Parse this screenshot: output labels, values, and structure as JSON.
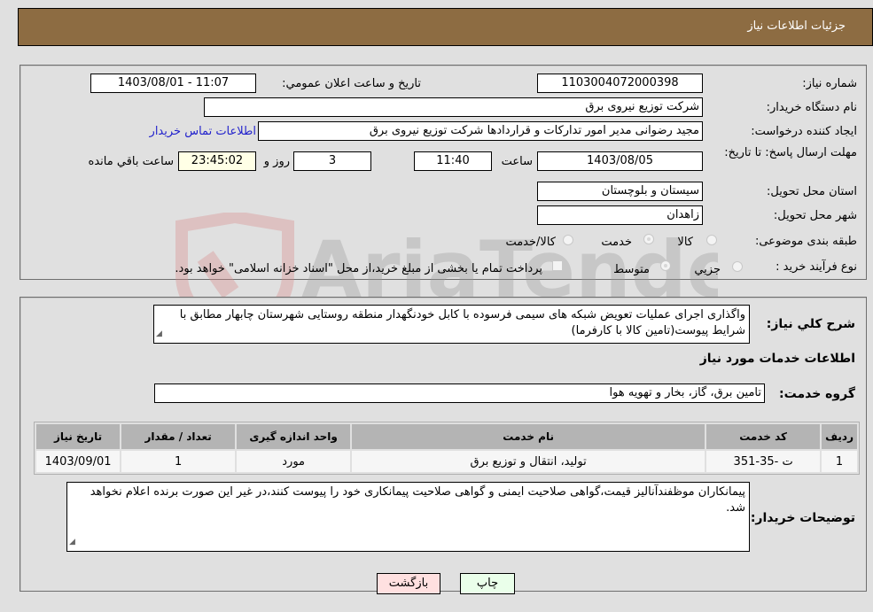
{
  "header": {
    "title": "جزئیات اطلاعات نیاز"
  },
  "fields": {
    "need_number_label": "شماره نیاز:",
    "need_number": "1103004072000398",
    "announce_label": "تاريخ و ساعت اعلان عمومي:",
    "announce_value": "1403/08/01 - 11:07",
    "buyer_org_label": "نام دستگاه خریدار:",
    "buyer_org": "شرکت توزیع نیروی برق",
    "creator_label": "ایجاد کننده درخواست:",
    "creator": "مجید  رضوانی مدیر امور تدارکات و قراردادها شرکت توزیع نیروی برق",
    "contact_link": "اطلاعات تماس خریدار",
    "deadline_label": "مهلت ارسال پاسخ: تا تاریخ:",
    "deadline_date": "1403/08/05",
    "time_label": "ساعت",
    "deadline_time": "11:40",
    "days_value": "3",
    "days_label": "روز و",
    "remaining_time": "23:45:02",
    "remaining_label": "ساعت باقي مانده",
    "province_label": "استان محل تحویل:",
    "province": "سیستان و بلوچستان",
    "city_label": "شهر محل تحویل:",
    "city": "زاهدان",
    "category_label": "طبقه بندی موضوعی:",
    "category_options": [
      "کالا",
      "خدمت",
      "کالا/خدمت"
    ],
    "category_selected": "خدمت",
    "process_label": "نوع فرآیند خرید :",
    "process_options": [
      "جزيي",
      "متوسط"
    ],
    "process_selected": "متوسط",
    "treasury_note": "پرداخت تمام یا بخشی از مبلغ خرید،از محل \"اسناد خزانه اسلامی\" خواهد بود."
  },
  "details": {
    "description_label": "شرح کلي نياز:",
    "description": "واگذاری اجرای عملیات تعویض شبکه های سیمی فرسوده با کابل خودنگهدار منطقه روستایی شهرستان چابهار مطابق با شرایط پیوست(تامین کالا با کارفرما)",
    "services_heading": "اطلاعات خدمات مورد نیاز",
    "service_group_label": "گروه خدمت:",
    "service_group": "تامین برق، گاز، بخار و تهویه هوا",
    "table": {
      "headers": [
        "ردیف",
        "کد خدمت",
        "نام خدمت",
        "واحد اندازه گیری",
        "تعداد / مقدار",
        "تاریخ نیاز"
      ],
      "rows": [
        [
          "1",
          "ت -35-351",
          "تولید، انتقال و توزیع برق",
          "مورد",
          "1",
          "1403/09/01"
        ]
      ]
    },
    "buyer_notes_label": "توضیحات خریدار:",
    "buyer_notes": "پیمانکاران موظفندآنالیز قیمت،گواهی صلاحیت ایمنی و گواهی صلاحیت پیمانکاری خود را پیوست کنند،در غیر این صورت برنده اعلام نخواهد شد."
  },
  "buttons": {
    "print": "چاپ",
    "back": "بازگشت"
  },
  "watermark": {
    "text": "AriaTender.neT"
  },
  "colors": {
    "header_bg": "#8d6c42",
    "print_bg": "#eaffea",
    "back_bg": "#ffe0e0",
    "link": "#2222cc"
  }
}
